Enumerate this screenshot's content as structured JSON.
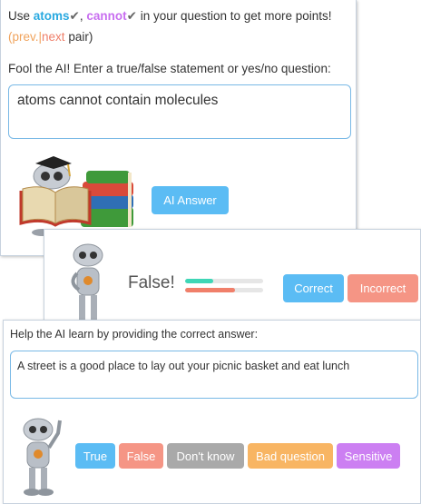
{
  "top_panel": {
    "hint_prefix": "Use ",
    "keyword1": "atoms",
    "check1": "✔",
    "comma": ", ",
    "keyword2": "cannot",
    "check2": "✔",
    "hint_suffix": " in your question to get more points!",
    "paren_open": "(",
    "prev_label": "prev.",
    "sep": "|",
    "next_label": "next",
    "pair_suffix": " pair)",
    "instruction": "Fool the AI! Enter a true/false statement or yes/no question:",
    "statement": "atoms cannot contain molecules",
    "ai_answer_button": "AI Answer"
  },
  "result_panel": {
    "verdict": "False!",
    "correct_button": "Correct",
    "incorrect_button": "Incorrect",
    "confidence_bars": [
      {
        "level": 0.36,
        "color": "#3ed6b6"
      },
      {
        "level": 0.64,
        "color": "#f07f6a"
      }
    ]
  },
  "feedback_panel": {
    "instruction": "Help the AI learn by providing the correct answer:",
    "statement": "A street is a good place to lay out your picnic basket and eat lunch",
    "buttons": [
      {
        "label": "True",
        "color": "#5bbcf4"
      },
      {
        "label": "False",
        "color": "#f59585"
      },
      {
        "label": "Don't know",
        "color": "#a9a9a9"
      },
      {
        "label": "Bad question",
        "color": "#f8b563"
      },
      {
        "label": "Sensitive",
        "color": "#cc7ff2"
      }
    ]
  },
  "colors": {
    "accent_blue": "#5bbcf4",
    "incorrect_red": "#f59585",
    "border": "#c7d2de"
  }
}
